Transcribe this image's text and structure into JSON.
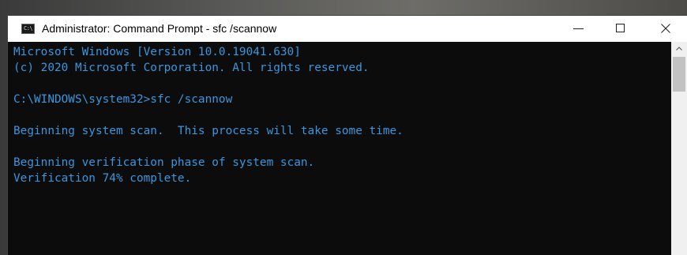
{
  "window": {
    "title": "Administrator: Command Prompt - sfc  /scannow",
    "app_icon_glyph": "C:\\"
  },
  "console": {
    "lines": [
      "Microsoft Windows [Version 10.0.19041.630]",
      "(c) 2020 Microsoft Corporation. All rights reserved.",
      "",
      "C:\\WINDOWS\\system32>sfc /scannow",
      "",
      "Beginning system scan.  This process will take some time.",
      "",
      "Beginning verification phase of system scan.",
      "Verification 74% complete."
    ],
    "text_color": "#3a96dd",
    "background_color": "#0c0c0c"
  },
  "icons": {
    "app": "command-prompt-icon",
    "minimize": "minimize-icon",
    "maximize": "maximize-icon",
    "close": "close-icon",
    "scroll_up": "chevron-up-icon"
  }
}
